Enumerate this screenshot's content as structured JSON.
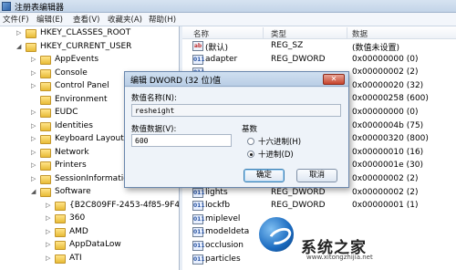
{
  "window": {
    "title": "注册表编辑器"
  },
  "menu": [
    "文件(F)",
    "编辑(E)",
    "查看(V)",
    "收藏夹(A)",
    "帮助(H)"
  ],
  "tree": [
    {
      "label": "HKEY_CLASSES_ROOT",
      "depth": 0,
      "expander": "▷"
    },
    {
      "label": "HKEY_CURRENT_USER",
      "depth": 0,
      "expander": "◢"
    },
    {
      "label": "AppEvents",
      "depth": 1,
      "expander": "▷"
    },
    {
      "label": "Console",
      "depth": 1,
      "expander": "▷"
    },
    {
      "label": "Control Panel",
      "depth": 1,
      "expander": "▷"
    },
    {
      "label": "Environment",
      "depth": 1,
      "expander": ""
    },
    {
      "label": "EUDC",
      "depth": 1,
      "expander": "▷"
    },
    {
      "label": "Identities",
      "depth": 1,
      "expander": "▷"
    },
    {
      "label": "Keyboard Layout",
      "depth": 1,
      "expander": "▷"
    },
    {
      "label": "Network",
      "depth": 1,
      "expander": "▷"
    },
    {
      "label": "Printers",
      "depth": 1,
      "expander": "▷"
    },
    {
      "label": "SessionInformation",
      "depth": 1,
      "expander": "▷"
    },
    {
      "label": "Software",
      "depth": 1,
      "expander": "◢"
    },
    {
      "label": "{B2C809FF-2453-4f85-9F40-2...",
      "depth": 2,
      "expander": "▷"
    },
    {
      "label": "360",
      "depth": 2,
      "expander": "▷"
    },
    {
      "label": "AMD",
      "depth": 2,
      "expander": "▷"
    },
    {
      "label": "AppDataLow",
      "depth": 2,
      "expander": "▷"
    },
    {
      "label": "ATI",
      "depth": 2,
      "expander": "▷"
    }
  ],
  "list_headers": {
    "name": "名称",
    "type": "类型",
    "data": "数据"
  },
  "list": [
    {
      "name": "(默认)",
      "type": "REG_SZ",
      "data": "(数值未设置)",
      "icon": "ab"
    },
    {
      "name": "adapter",
      "type": "REG_DWORD",
      "data": "0x00000000 (0)",
      "icon": "bin"
    },
    {
      "name": "",
      "type": "",
      "data": "0x00000002 (2)",
      "icon": "bin"
    },
    {
      "name": "",
      "type": "",
      "data": "0x00000020 (32)",
      "icon": "bin"
    },
    {
      "name": "",
      "type": "",
      "data": "0x00000258 (600)",
      "icon": "bin"
    },
    {
      "name": "",
      "type": "",
      "data": "0x00000000 (0)",
      "icon": "bin"
    },
    {
      "name": "",
      "type": "",
      "data": "0x0000004b (75)",
      "icon": "bin"
    },
    {
      "name": "",
      "type": "",
      "data": "0x00000320 (800)",
      "icon": "bin"
    },
    {
      "name": "",
      "type": "",
      "data": "0x00000010 (16)",
      "icon": "bin"
    },
    {
      "name": "",
      "type": "",
      "data": "0x0000001e (30)",
      "icon": "bin"
    },
    {
      "name": "",
      "type": "",
      "data": "0x00000002 (2)",
      "icon": "bin"
    },
    {
      "name": "lights",
      "type": "REG_DWORD",
      "data": "0x00000002 (2)",
      "icon": "bin"
    },
    {
      "name": "lockfb",
      "type": "REG_DWORD",
      "data": "0x00000001 (1)",
      "icon": "bin"
    },
    {
      "name": "miplevel",
      "type": "",
      "data": "",
      "icon": "bin"
    },
    {
      "name": "modeldeta",
      "type": "",
      "data": "",
      "icon": "bin"
    },
    {
      "name": "occlusion",
      "type": "",
      "data": "",
      "icon": "bin"
    },
    {
      "name": "particles",
      "type": "",
      "data": "",
      "icon": "bin"
    }
  ],
  "dialog": {
    "title": "编辑 DWORD (32 位)值",
    "close": "✕",
    "name_label": "数值名称(N):",
    "name_value": "resheight",
    "data_label": "数值数据(V):",
    "data_value": "600",
    "base_label": "基数",
    "hex_label": "十六进制(H)",
    "dec_label": "十进制(D)",
    "selected_base": "dec",
    "ok": "确定",
    "cancel": "取消"
  },
  "watermark": {
    "text": "系统之家",
    "url": "www.xitongzhijia.net"
  }
}
